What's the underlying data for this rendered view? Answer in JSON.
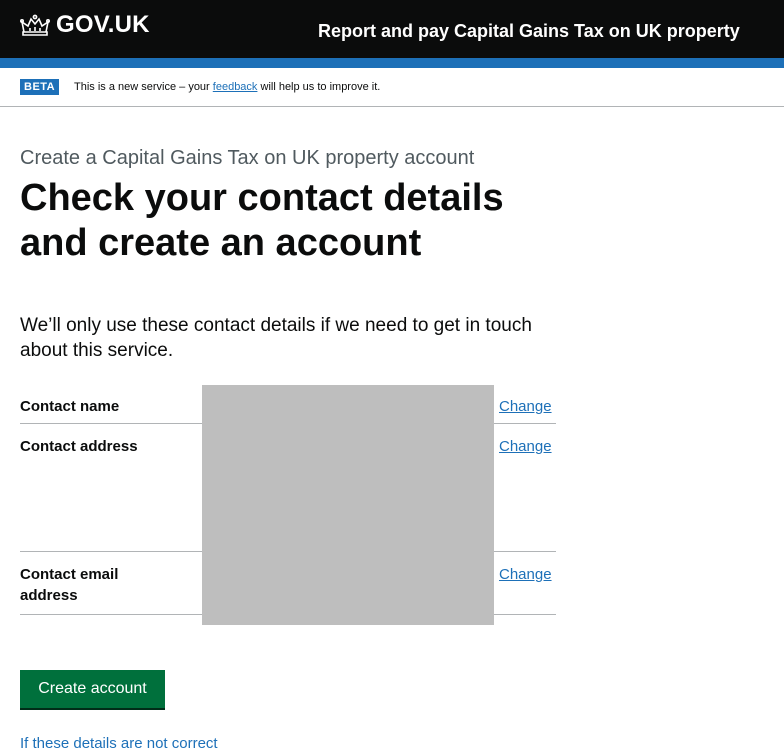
{
  "header": {
    "logo_text": "GOV.UK",
    "service_name": "Report and pay Capital Gains Tax on UK property"
  },
  "phase_banner": {
    "tag": "BETA",
    "text_before": "This is a new service – your ",
    "link_text": "feedback",
    "text_after": " will help us to improve it."
  },
  "main": {
    "caption": "Create a Capital Gains Tax on UK property account",
    "heading": "Check your contact details and create an account",
    "lede": "We’ll only use these contact details if we need to get in touch about this service.",
    "summary": [
      {
        "key": "Contact name",
        "action": "Change"
      },
      {
        "key": "Contact address",
        "action": "Change"
      },
      {
        "key": "Contact email address",
        "action": "Change"
      }
    ],
    "button_label": "Create account",
    "link_text": "If these details are not correct"
  },
  "colors": {
    "header_bg": "#0b0c0c",
    "brand_blue": "#1d70b8",
    "button_green": "#00703c",
    "redaction_grey": "#bebebe"
  }
}
